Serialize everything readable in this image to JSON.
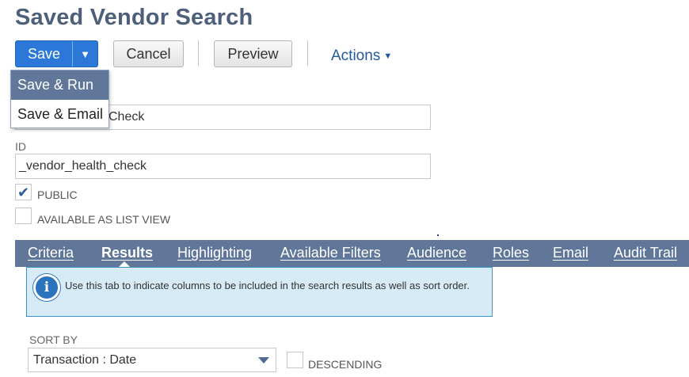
{
  "page": {
    "title": "Saved Vendor Search"
  },
  "toolbar": {
    "save_label": "Save",
    "save_menu_arrow": "▼",
    "cancel_label": "Cancel",
    "preview_label": "Preview",
    "actions_label": "Actions",
    "actions_caret": "▼"
  },
  "save_menu": {
    "items": [
      "Save & Run",
      "Save & Email"
    ],
    "highlighted": "Save & Run"
  },
  "form": {
    "name_value": "Check",
    "id_label": "ID",
    "id_value": "_vendor_health_check",
    "public_label": "PUBLIC",
    "public_checked": true,
    "public_check_glyph": "✔",
    "list_view_label": "AVAILABLE AS LIST VIEW",
    "list_view_checked": false
  },
  "tabs": {
    "items": [
      "Criteria",
      "Results",
      "Highlighting",
      "Available Filters",
      "Audience",
      "Roles",
      "Email",
      "Audit Trail"
    ],
    "active": "Results"
  },
  "info": {
    "icon": "info-icon",
    "icon_glyph": "i",
    "message": "Use this tab to indicate columns to be included in the search results as well as sort order."
  },
  "sort": {
    "label": "SORT BY",
    "value": "Transaction : Date",
    "descending_label": "DESCENDING",
    "descending_checked": false
  },
  "colors": {
    "title": "#4d5f79",
    "primary_button": "#2c78d8",
    "tab_bar": "#607799",
    "link": "#24589c",
    "info_background": "#d6ebf6",
    "info_border": "#3a93c6"
  }
}
